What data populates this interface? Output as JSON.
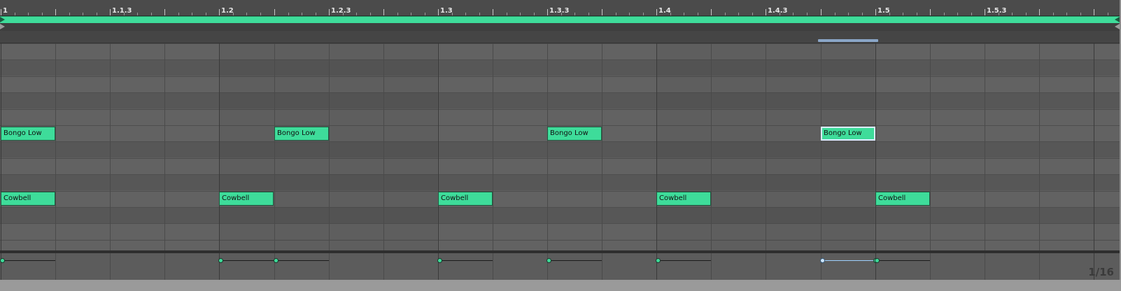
{
  "ruler": {
    "labels": [
      "1",
      "1.1.3",
      "1.2",
      "1.2.3",
      "1.3",
      "1.3.3",
      "1.4",
      "1.4.3",
      "1.5",
      "1.5.3"
    ]
  },
  "loop": {
    "enabled": true,
    "color": "#3edc9a"
  },
  "notes": [
    {
      "name": "Bongo Low",
      "lane": 5,
      "start": 0,
      "length": 1,
      "selected": false
    },
    {
      "name": "Bongo Low",
      "lane": 5,
      "start": 5,
      "length": 1,
      "selected": false
    },
    {
      "name": "Bongo Low",
      "lane": 5,
      "start": 10,
      "length": 1,
      "selected": false
    },
    {
      "name": "Bongo Low",
      "lane": 5,
      "start": 15,
      "length": 1,
      "selected": true
    },
    {
      "name": "Cowbell",
      "lane": 9,
      "start": 0,
      "length": 1,
      "selected": false
    },
    {
      "name": "Cowbell",
      "lane": 9,
      "start": 4,
      "length": 1,
      "selected": false
    },
    {
      "name": "Cowbell",
      "lane": 9,
      "start": 8,
      "length": 1,
      "selected": false
    },
    {
      "name": "Cowbell",
      "lane": 9,
      "start": 12,
      "length": 1,
      "selected": false
    },
    {
      "name": "Cowbell",
      "lane": 9,
      "start": 16,
      "length": 1,
      "selected": false
    }
  ],
  "velocity_marks": [
    {
      "start": 0,
      "length": 1,
      "selected": false
    },
    {
      "start": 4,
      "length": 1,
      "selected": false
    },
    {
      "start": 5,
      "length": 1,
      "selected": false
    },
    {
      "start": 8,
      "length": 1,
      "selected": false
    },
    {
      "start": 10,
      "length": 1,
      "selected": false
    },
    {
      "start": 12,
      "length": 1,
      "selected": false
    },
    {
      "start": 15,
      "length": 1,
      "selected": true
    },
    {
      "start": 16,
      "length": 1,
      "selected": false
    }
  ],
  "selection": {
    "start": 15,
    "length": 1,
    "color": "#8aa6c7"
  },
  "grid_readout": "1/16",
  "colors": {
    "note": "#3edc9a",
    "selected_outline": "#d9ecff"
  }
}
